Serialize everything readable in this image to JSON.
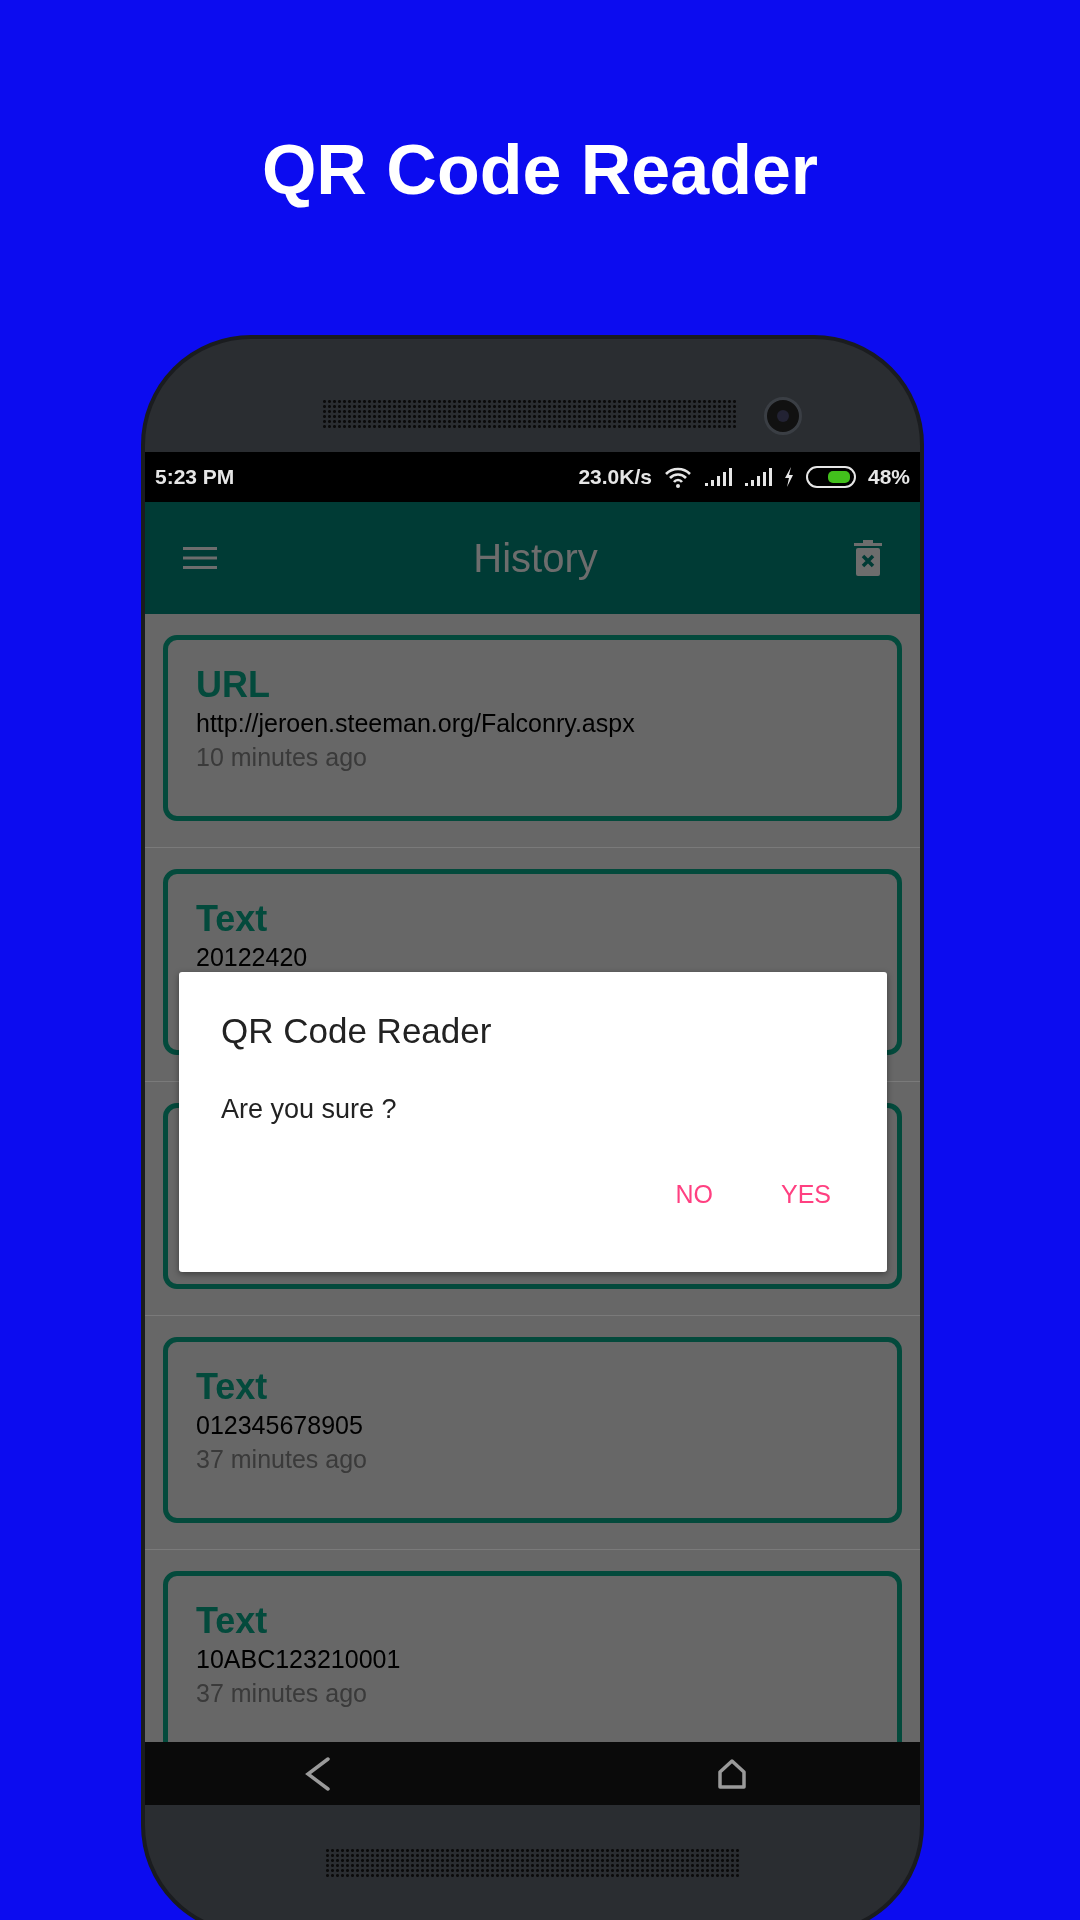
{
  "headline": "QR Code Reader",
  "status_bar": {
    "time": "5:23 PM",
    "speed": "23.0K/s",
    "battery": "48%"
  },
  "app_bar": {
    "title": "History"
  },
  "history": [
    {
      "kind": "entry",
      "type": "URL",
      "value": "http://jeroen.steeman.org/Falconry.aspx",
      "time": "10 minutes ago"
    },
    {
      "kind": "entry",
      "type": "Text",
      "value": "20122420"
    },
    {
      "kind": "covered"
    },
    {
      "kind": "entry",
      "type": "Text",
      "value": "012345678905",
      "time": "37 minutes ago"
    },
    {
      "kind": "entry",
      "type": "Text",
      "value": "10ABC123210001",
      "time": "37 minutes ago"
    }
  ],
  "dialog": {
    "title": "QR Code Reader",
    "message": "Are you sure ?",
    "buttons": [
      "NO",
      "YES"
    ]
  }
}
